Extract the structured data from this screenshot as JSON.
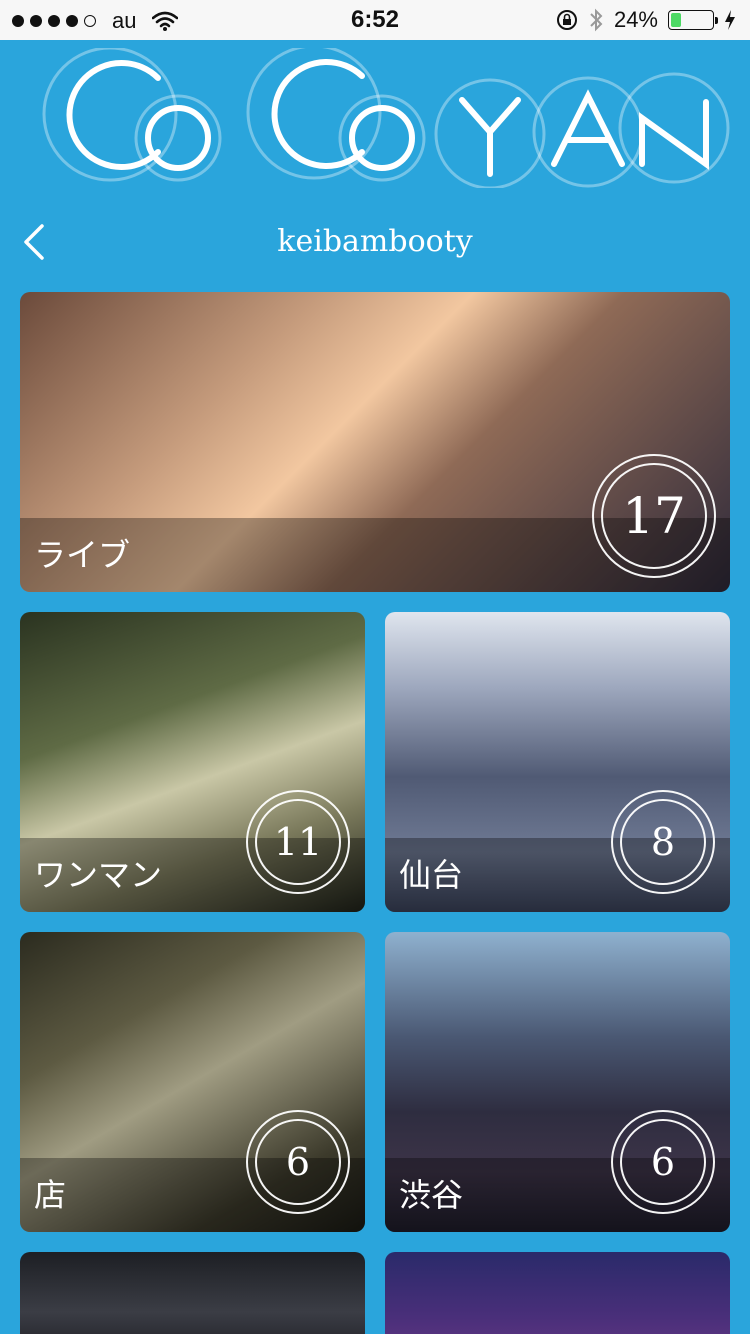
{
  "status_bar": {
    "carrier": "au",
    "time": "6:52",
    "battery_percent": "24%",
    "battery_level": 0.24,
    "signal_bars_filled": 4,
    "signal_bars_total": 5,
    "icons": [
      "wifi-icon",
      "orientation-lock-icon",
      "bluetooth-icon",
      "charging-icon"
    ]
  },
  "logo": {
    "text": "CoCoYAN"
  },
  "header": {
    "title": "keibambooty",
    "back_icon": "chevron-left-icon"
  },
  "albums": [
    {
      "label": "ライブ",
      "count": "17"
    },
    {
      "label": "ワンマン",
      "count": "11"
    },
    {
      "label": "仙台",
      "count": "8"
    },
    {
      "label": "店",
      "count": "6"
    },
    {
      "label": "渋谷",
      "count": "6"
    }
  ],
  "colors": {
    "background": "#2aa5dc",
    "status_bar": "#f7f7f7",
    "battery_fill": "#4cd964",
    "text_light": "#ffffff"
  }
}
